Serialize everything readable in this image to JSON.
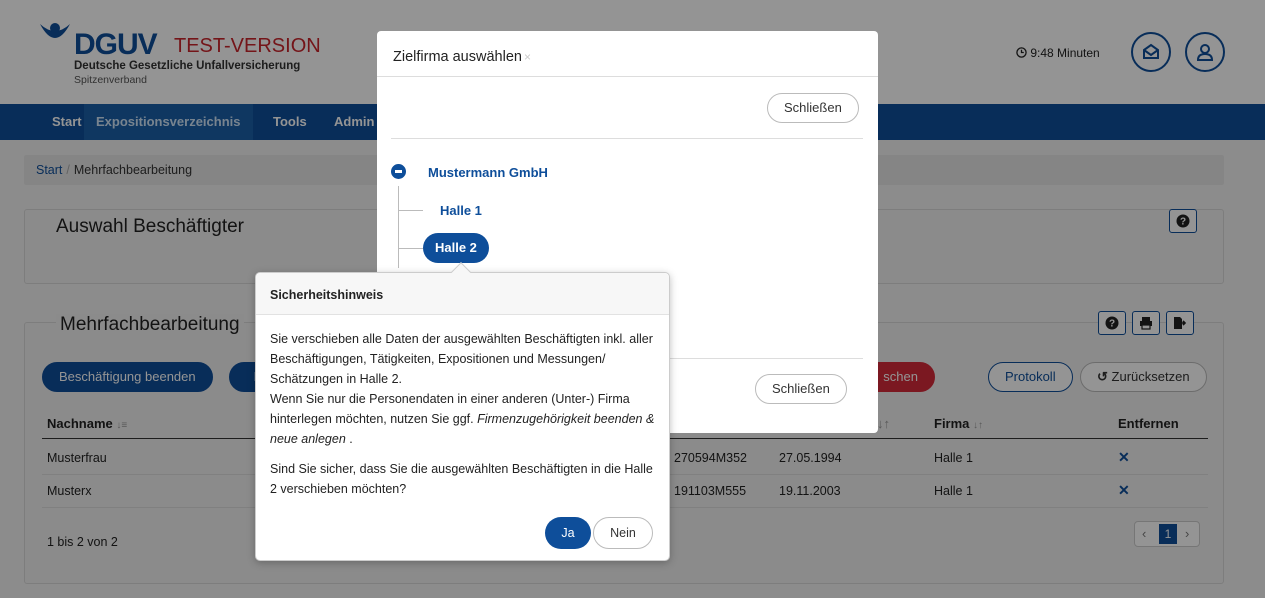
{
  "header": {
    "logo_text": "DGUV",
    "test_version": "TEST-VERSION",
    "org_name": "Deutsche Gesetzliche Unfallversicherung",
    "org_sub": "Spitzenverband",
    "timer": "9:48 Minuten"
  },
  "nav": {
    "items": [
      "Start",
      "Expositionsverzeichnis",
      "Tools",
      "Admin"
    ]
  },
  "breadcrumb": {
    "start": "Start",
    "current": "Mehrfachbearbeitung"
  },
  "auswahl": {
    "title": "Auswahl Beschäftigter"
  },
  "mehrfach": {
    "title": "Mehrfachbearbeitung",
    "btn_beenden": "Beschäftigung beenden",
    "btn_partial": "Fi",
    "btn_loeschen_partial": "schen",
    "btn_protokoll": "Protokoll",
    "btn_reset": "Zurücksetzen"
  },
  "table": {
    "col_nachname": "Nachname",
    "col_firma": "Firma",
    "col_entfernen": "Entfernen",
    "rows": [
      {
        "nachname": "Musterfrau",
        "id": "270594M352",
        "datum": "27.05.1994",
        "firma": "Halle 1"
      },
      {
        "nachname": "Musterx",
        "id": "191103M555",
        "datum": "19.11.2003",
        "firma": "Halle 1"
      }
    ],
    "range": "1 bis 2 von 2",
    "page": "1"
  },
  "modal": {
    "title": "Zielfirma auswählen",
    "close_top": "Schließen",
    "close_bottom": "Schließen",
    "tree_root": "Mustermann GmbH",
    "tree_children": [
      "Halle 1",
      "Halle 2"
    ]
  },
  "popover": {
    "title": "Sicherheitshinweis",
    "p1": "Sie verschieben alle Daten der ausgewählten Beschäftigten inkl. aller Beschäftigungen, Tätigkeiten, Expositionen und Messungen/ Schätzungen in Halle 2.",
    "p2_a": "Wenn Sie nur die Personendaten in einer anderen (Unter-) Firma hinterlegen möchten, nutzen Sie ggf.",
    "p2_em": "Firmenzugehörigkeit beenden & neue anlegen",
    "p2_b": ".",
    "p3": "Sind Sie sicher, dass Sie die ausgewählten Beschäftigten in die Halle 2 verschieben möchten?",
    "btn_ja": "Ja",
    "btn_nein": "Nein"
  },
  "colors": {
    "brand": "#0e4e9a",
    "danger": "#d42a3a",
    "test": "#c9252c"
  }
}
